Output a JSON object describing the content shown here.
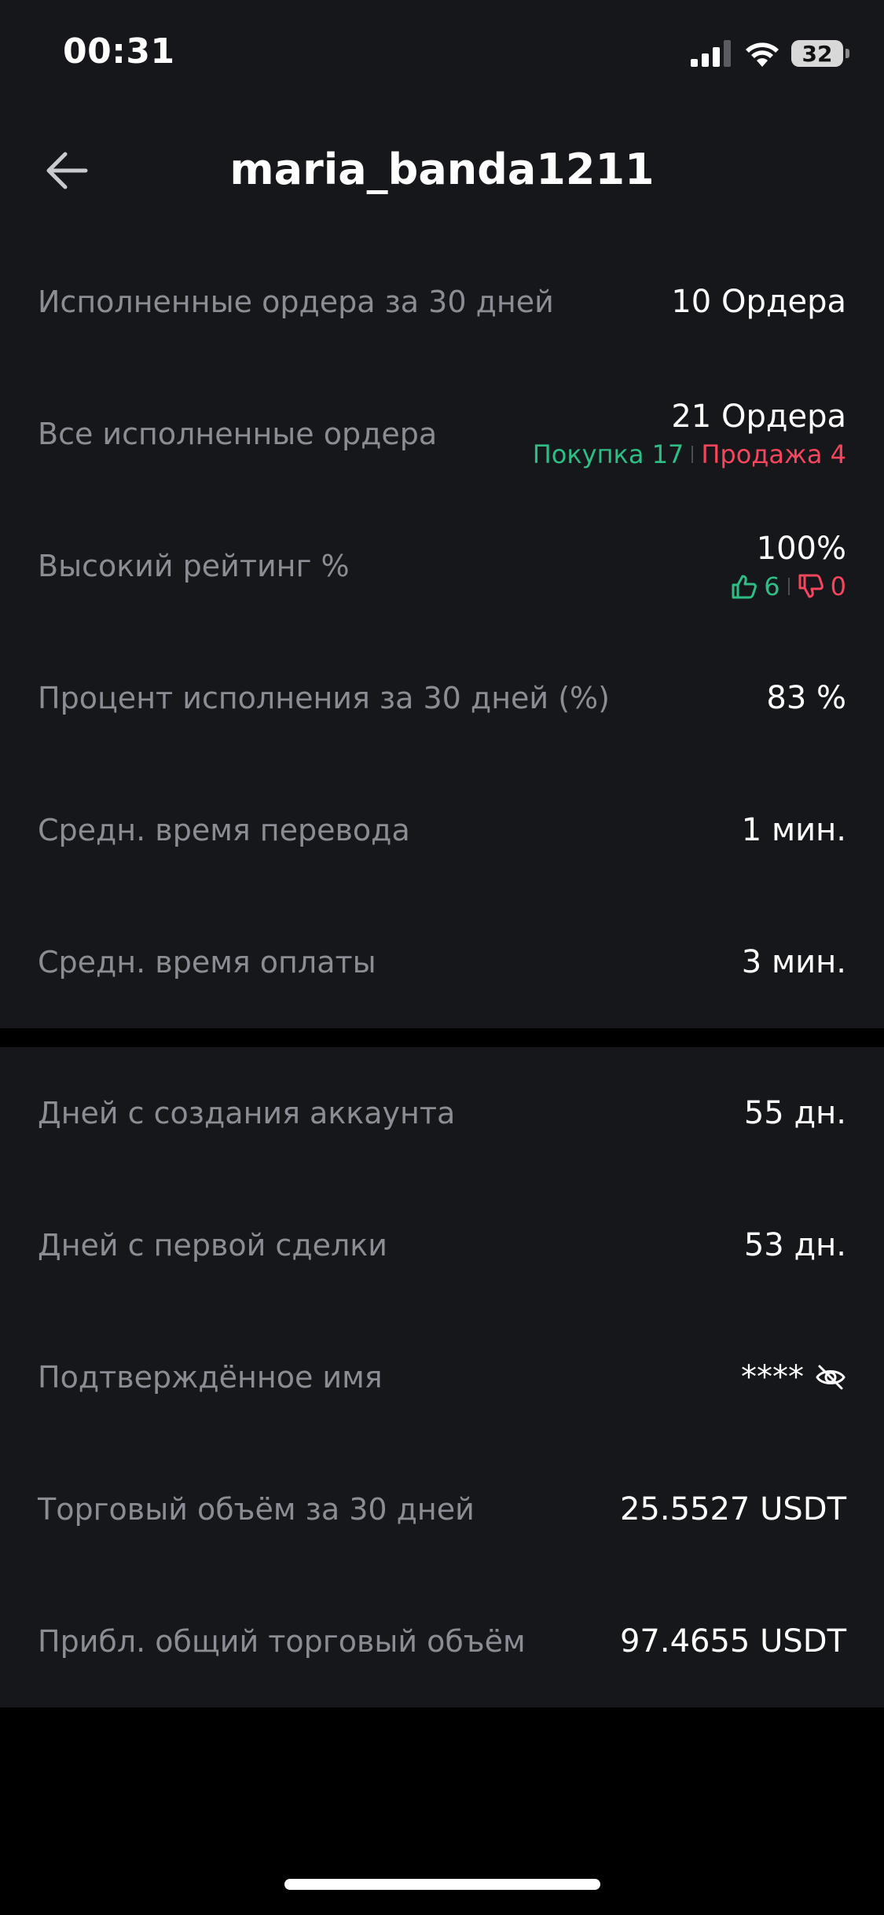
{
  "status_bar": {
    "time": "00:31",
    "battery": "32"
  },
  "header": {
    "title": "maria_banda1211"
  },
  "stats_top": [
    {
      "label": "Исполненные ордера за 30 дней",
      "value": "10 Ордера"
    },
    {
      "label": "Все исполненные ордера",
      "value": "21 Ордера",
      "buy": "Покупка 17",
      "sell": "Продажа 4"
    },
    {
      "label": "Высокий рейтинг %",
      "value": "100%",
      "likes": "6",
      "dislikes": "0"
    },
    {
      "label": "Процент исполнения за 30 дней (%)",
      "value": "83 %"
    },
    {
      "label": "Средн. время перевода",
      "value": "1 мин."
    },
    {
      "label": "Средн. время оплаты",
      "value": "3 мин."
    }
  ],
  "stats_bottom": [
    {
      "label": "Дней с создания аккаунта",
      "value": "55 дн."
    },
    {
      "label": "Дней с первой сделки",
      "value": "53 дн."
    },
    {
      "label": "Подтверждённое имя",
      "value": "****"
    },
    {
      "label": "Торговый объём за 30 дней",
      "value": "25.5527 USDT"
    },
    {
      "label": "Прибл. общий торговый объём",
      "value": "97.4655 USDT"
    }
  ],
  "colors": {
    "background": "#000000",
    "card": "#16171b",
    "label": "#8a8d94",
    "value": "#ffffff",
    "buy": "#2ebd85",
    "sell": "#f6465d"
  },
  "icons": {
    "back": "arrow-left-icon",
    "like": "thumbs-up-icon",
    "dislike": "thumbs-down-icon",
    "hidden": "eye-off-icon",
    "signal": "signal-icon",
    "wifi": "wifi-icon",
    "battery": "battery-icon"
  }
}
